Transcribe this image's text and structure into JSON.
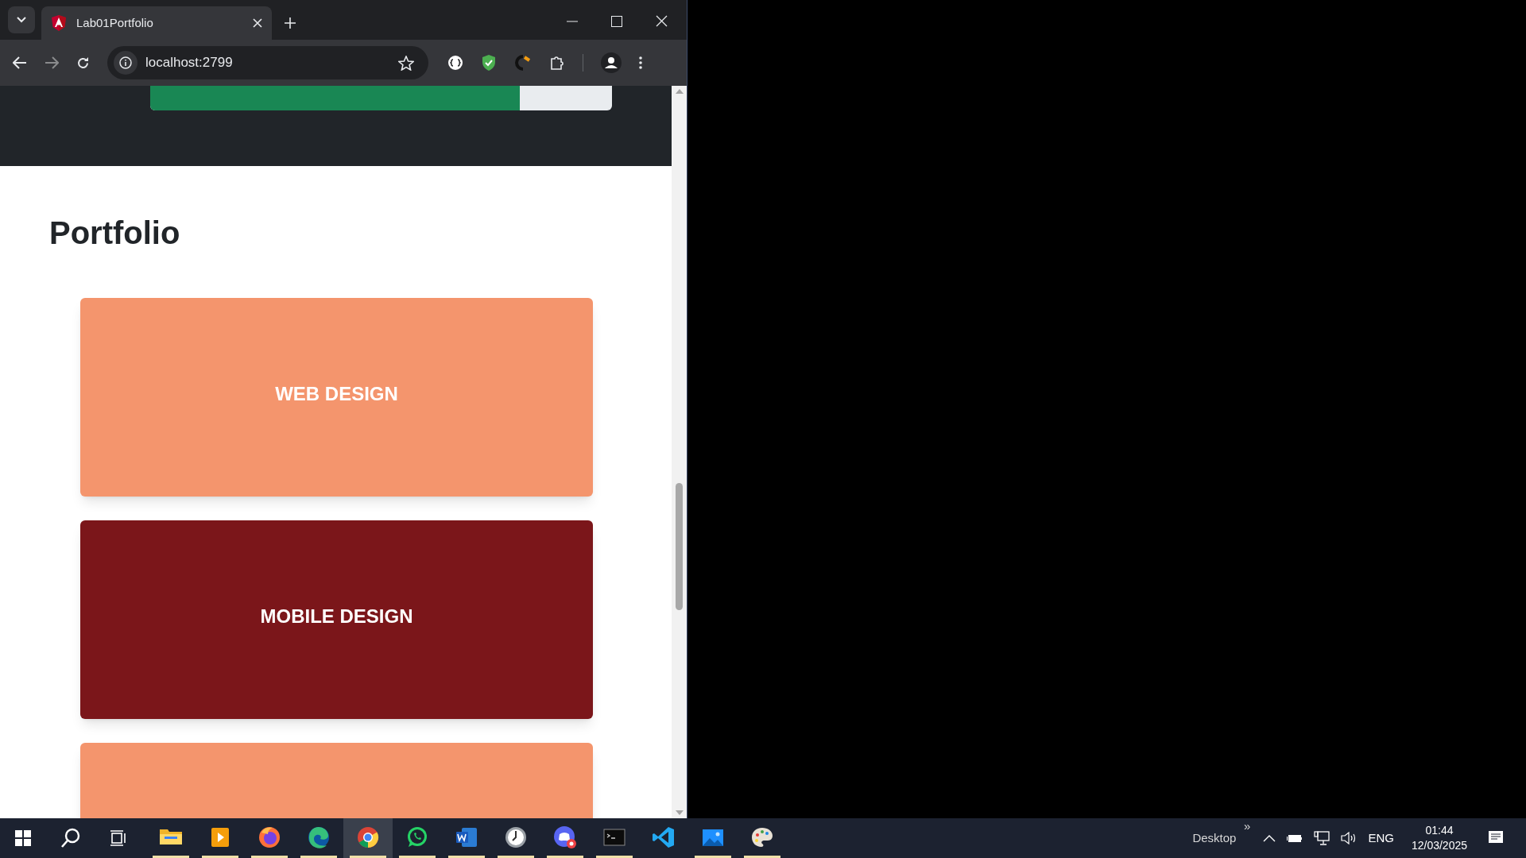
{
  "browser": {
    "tab": {
      "title": "Lab01Portfolio",
      "selected": true
    },
    "address": "localhost:2799"
  },
  "page": {
    "progress": {
      "level": 0.8
    },
    "heading": "Portfolio",
    "cards": [
      {
        "title": "WEB DESIGN",
        "color": "#f4956d"
      },
      {
        "title": "MOBILE DESIGN",
        "color": "#7b161a"
      },
      {
        "color": "#f4956d"
      }
    ]
  },
  "taskbar": {
    "apps": [
      {
        "kind": "files",
        "running": true,
        "selected": false
      },
      {
        "kind": "media",
        "running": true,
        "selected": false
      },
      {
        "kind": "firefox",
        "running": true,
        "selected": false
      },
      {
        "kind": "edge",
        "running": true,
        "selected": false
      },
      {
        "kind": "chrome",
        "running": true,
        "selected": true
      },
      {
        "kind": "whatsapp",
        "running": true,
        "selected": false
      },
      {
        "kind": "word",
        "running": true,
        "selected": false
      },
      {
        "kind": "clock",
        "running": true,
        "selected": false
      },
      {
        "kind": "discord",
        "running": true,
        "selected": false
      },
      {
        "kind": "terminal",
        "running": true,
        "selected": false
      },
      {
        "kind": "vscode",
        "running": false,
        "selected": false
      },
      {
        "kind": "photos",
        "running": true,
        "selected": false
      },
      {
        "kind": "paint",
        "running": true,
        "selected": false
      }
    ],
    "toolbar_label": "Desktop",
    "toolbar_more": "»",
    "language": "ENG",
    "time": "01:44",
    "date": "12/03/2025"
  }
}
